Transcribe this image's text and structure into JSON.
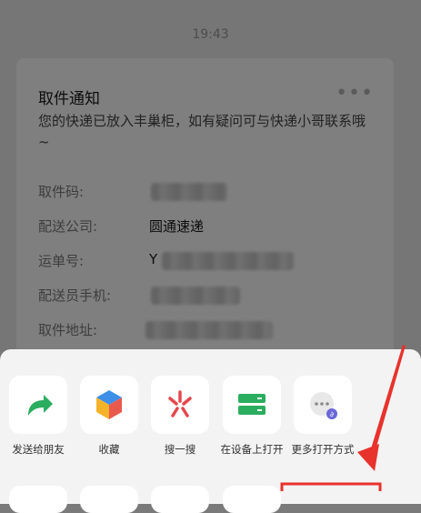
{
  "status_bar": {
    "time": "19:43"
  },
  "card": {
    "title": "取件通知",
    "description": "您的快递已放入丰巢柜，如有疑问可与快递小哥联系哦~",
    "fields": [
      {
        "label": "取件码:",
        "value": ""
      },
      {
        "label": "配送公司:",
        "value": "圆通速递"
      },
      {
        "label": "运单号:",
        "value": "Y"
      },
      {
        "label": "配送员手机:",
        "value": ""
      },
      {
        "label": "取件地址:",
        "value": ""
      }
    ]
  },
  "share_sheet": {
    "items": [
      {
        "label": "发送给朋友",
        "icon": "share-arrow-icon"
      },
      {
        "label": "收藏",
        "icon": "favorite-cube-icon"
      },
      {
        "label": "搜一搜",
        "icon": "search-star-icon"
      },
      {
        "label": "在设备上打开",
        "icon": "device-icon"
      },
      {
        "label": "更多打开方式",
        "icon": "more-open-icon"
      }
    ]
  },
  "colors": {
    "accent_green": "#2bad5f",
    "annotation_red": "#e8322c"
  }
}
